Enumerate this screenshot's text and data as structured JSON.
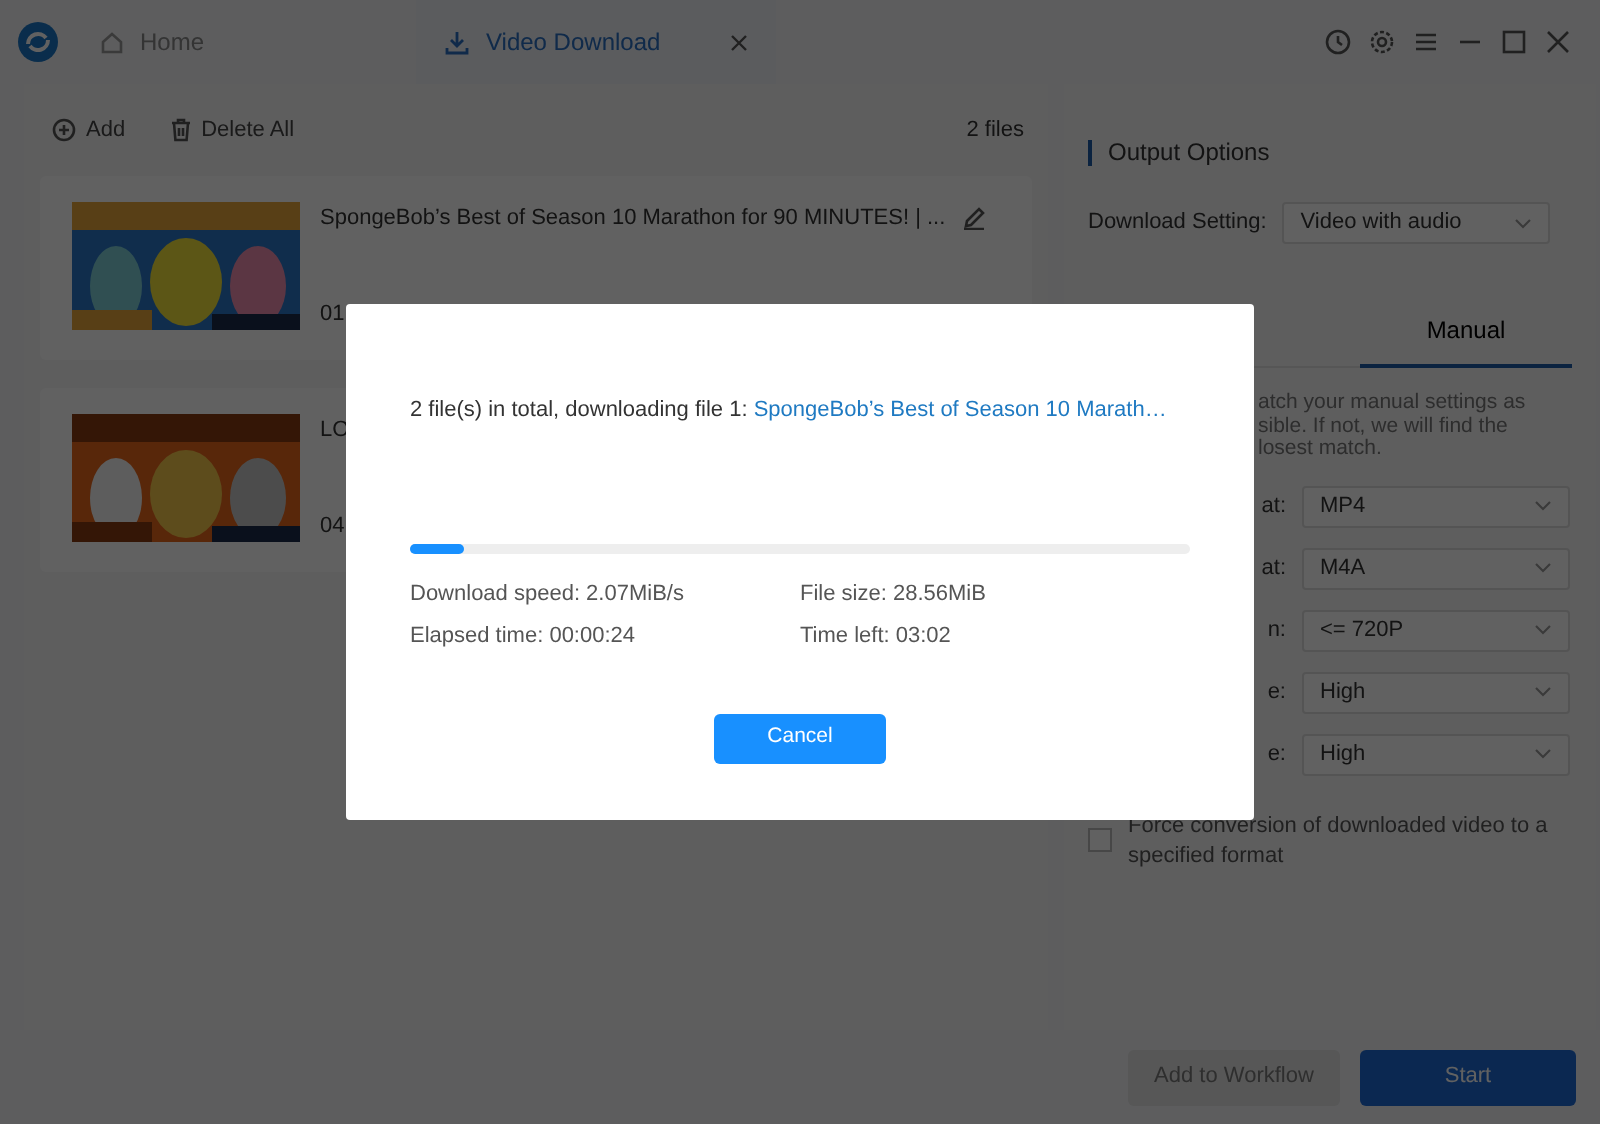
{
  "tabs": [
    {
      "label": "Home",
      "selected": false
    },
    {
      "label": "Video Download",
      "selected": true
    }
  ],
  "toolbar": {
    "add": "Add",
    "delete_all": "Delete All",
    "file_count": "2 files"
  },
  "items": [
    {
      "title": "SpongeBob’s Best of Season 10 Marathon for 90 MINUTES! | ...",
      "duration": "01",
      "editable": true
    },
    {
      "title": "LO",
      "duration": "04"
    }
  ],
  "output_options": {
    "title": "Output Options",
    "download_setting": {
      "label": "Download Setting:",
      "value": "Video with audio"
    },
    "tabs": [
      {
        "label": "Manual",
        "selected": true
      }
    ],
    "note_lines": [
      "atch your manual settings as",
      "sible. If not, we will find the",
      "losest match."
    ],
    "settings": [
      {
        "label": "at:",
        "value": "MP4"
      },
      {
        "label": "at:",
        "value": "M4A"
      },
      {
        "label": "n:",
        "value": "<= 720P"
      },
      {
        "label": "e:",
        "value": "High"
      },
      {
        "label": "e:",
        "value": "High"
      }
    ],
    "force_conversion": {
      "label": "Force conversion of downloaded video to a specified format",
      "checked": false
    }
  },
  "footer": {
    "buttons": [
      {
        "label": "Add to Workflow",
        "disabled": true
      },
      {
        "label": "Start",
        "disabled": false
      }
    ]
  },
  "dialog": {
    "message": "2 file(s) in total, downloading file 1: ",
    "file_name": "SpongeBob’s Best of Season 10 Marath…",
    "progress": {
      "level": 0.07
    },
    "stats": [
      "Download speed: 2.07MiB/s",
      "File size: 28.56MiB",
      "Elapsed time: 00:00:24",
      "Time left: 03:02"
    ],
    "button": "Cancel"
  }
}
